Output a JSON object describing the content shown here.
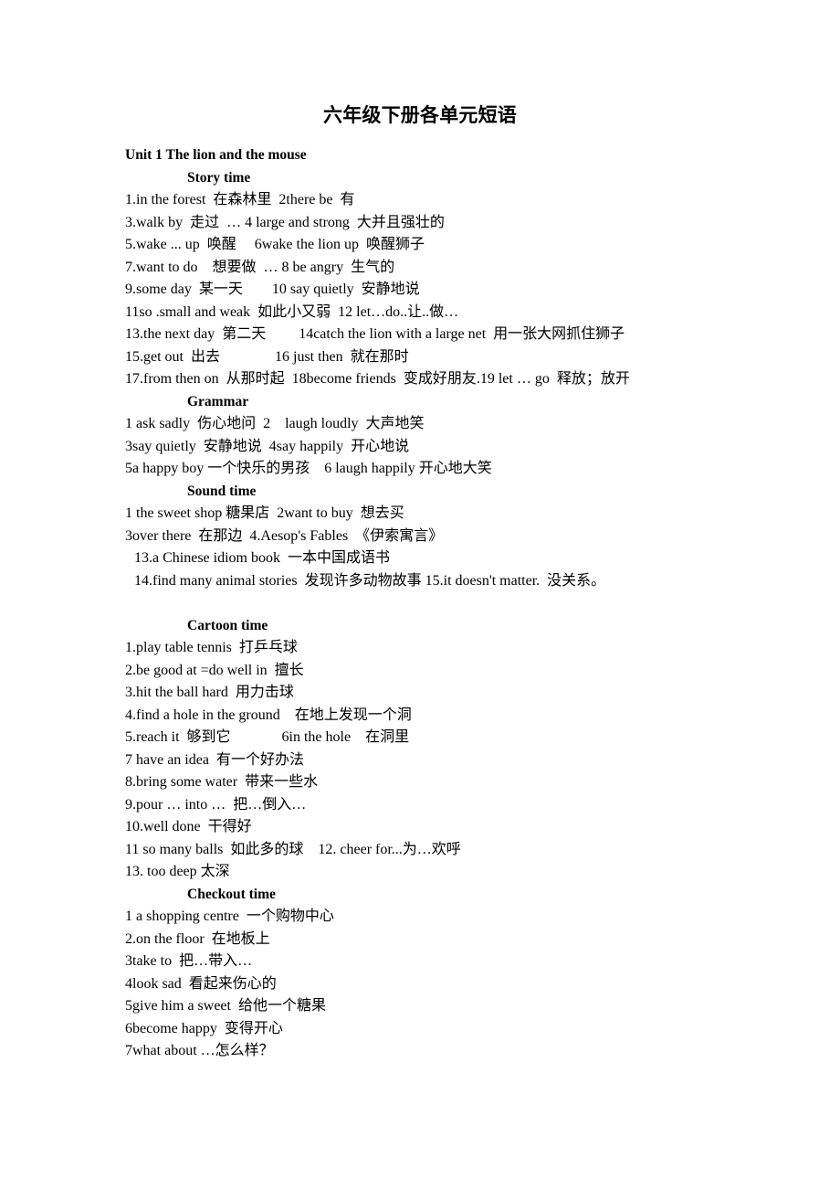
{
  "document": {
    "title": "六年级下册各单元短语",
    "unit_heading": "Unit 1 The lion and the mouse"
  },
  "sections": {
    "story_time": {
      "heading": "Story time",
      "lines": [
        "1.in the forest  在森林里  2there be  有",
        "3.walk by  走过  … 4 large and strong  大并且强壮的",
        "5.wake ... up  唤醒     6wake the lion up  唤醒狮子",
        "7.want to do    想要做  … 8 be angry  生气的",
        "9.some day  某一天        10 say quietly  安静地说",
        "11so .small and weak  如此小又弱  12 let…do..让..做…",
        "13.the next day  第二天         14catch the lion with a large net  用一张大网抓住狮子",
        "15.get out  出去               16 just then  就在那时",
        "17.from then on  从那时起  18become friends  变成好朋友.19 let … go  释放；放开"
      ]
    },
    "grammar": {
      "heading": "Grammar",
      "lines": [
        "1 ask sadly  伤心地问  2    laugh loudly  大声地笑",
        "3say quietly  安静地说  4say happily  开心地说",
        "5a happy boy 一个快乐的男孩    6 laugh happily 开心地大笑"
      ]
    },
    "sound_time": {
      "heading": "Sound time",
      "lines": [
        "1 the sweet shop 糖果店  2want to buy  想去买",
        "3over there  在那边  4.Aesop's Fables  《伊索寓言》",
        "13.a Chinese idiom book  一本中国成语书",
        "14.find many animal stories  发现许多动物故事 15.it doesn't matter.  没关系。"
      ]
    },
    "cartoon_time": {
      "heading": "Cartoon time",
      "lines": [
        "1.play table tennis  打乒乓球",
        "2.be good at =do well in  擅长",
        "3.hit the ball hard  用力击球",
        "4.find a hole in the ground    在地上发现一个洞",
        "5.reach it  够到它              6in the hole    在洞里",
        "7 have an idea  有一个好办法",
        "8.bring some water  带来一些水",
        "9.pour … into …  把…倒入…",
        "10.well done  干得好",
        "11 so many balls  如此多的球    12. cheer for...为…欢呼",
        "13. too deep 太深"
      ]
    },
    "checkout_time": {
      "heading": "Checkout time",
      "lines": [
        "1 a shopping centre  一个购物中心",
        "2.on the floor  在地板上",
        "3take to  把…带入…",
        "4look sad  看起来伤心的",
        "5give him a sweet  给他一个糖果",
        "6become happy  变得开心",
        "7what about …怎么样？"
      ]
    }
  }
}
